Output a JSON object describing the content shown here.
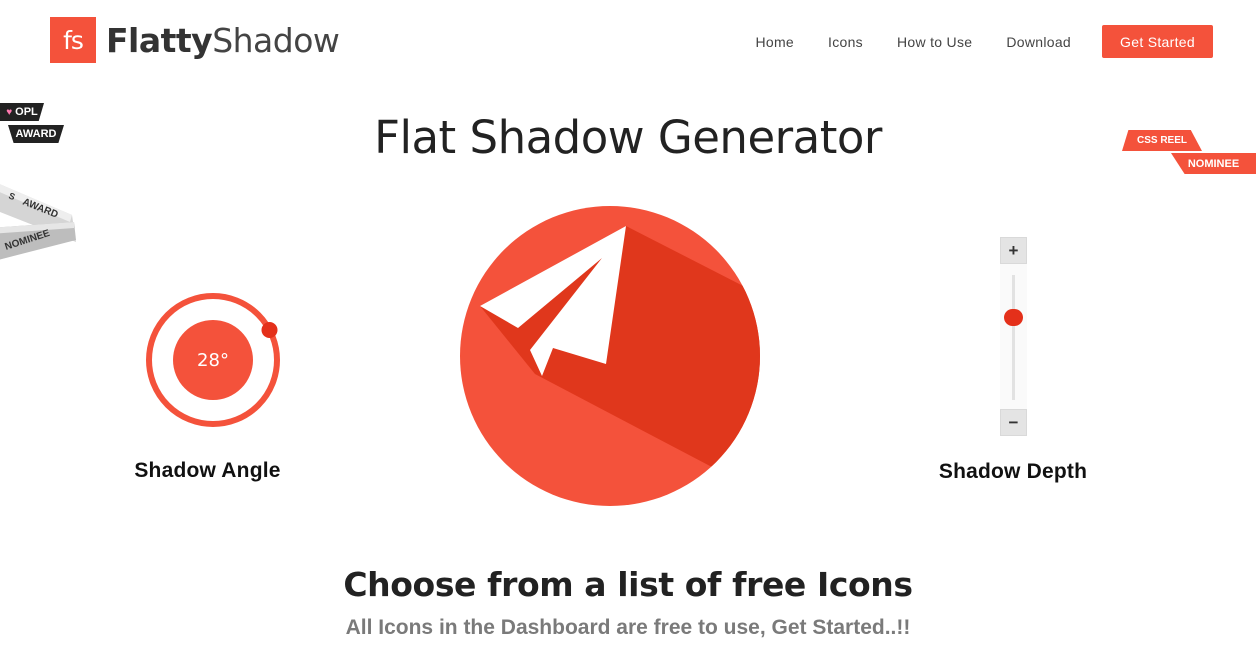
{
  "brand": {
    "mark": "fs",
    "name_bold": "Flatty",
    "name_light": "Shadow",
    "color": "#f4523b"
  },
  "nav": {
    "items": [
      {
        "label": "Home"
      },
      {
        "label": "Icons"
      },
      {
        "label": "How to Use"
      },
      {
        "label": "Download"
      }
    ],
    "cta_label": "Get Started"
  },
  "ribbons": {
    "opl_line1": "OPL",
    "opl_line2": "AWARD",
    "css_line1": "CSS REEL",
    "css_line2": "NOMINEE",
    "silver_line1": "AWARD",
    "silver_line2": "NOMINEE"
  },
  "page_title": "Flat Shadow Generator",
  "angle_control": {
    "value": "28°",
    "angle_degrees": 28,
    "label": "Shadow Angle"
  },
  "preview": {
    "icon": "paper-plane-icon",
    "bg_color": "#f4523b",
    "shadow_color": "#e0371c"
  },
  "depth_control": {
    "increase_label": "+",
    "decrease_label": "−",
    "level_fraction": 0.35,
    "label": "Shadow Depth"
  },
  "section": {
    "heading": "Choose from a list of free Icons",
    "tagline": "All Icons in the Dashboard are free to use, Get Started..!!"
  }
}
